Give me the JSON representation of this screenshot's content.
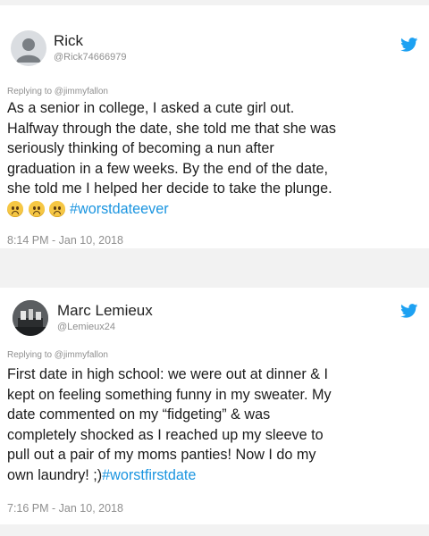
{
  "colors": {
    "accent": "#1b95e0",
    "muted": "#8f8f8f"
  },
  "tweets": [
    {
      "name": "Rick",
      "handle": "@Rick74666979",
      "replying": "Replying to @jimmyfallon",
      "lines": [
        "As a senior in college, I asked a cute girl out.",
        "Halfway through the date, she told me that she was",
        "seriously thinking of becoming a nun after",
        "graduation in a few weeks. By the end of the date,",
        "she told me I helped her decide to take the plunge."
      ],
      "emoji": "worried-face-icon",
      "hashtag": "#worstdateever",
      "timestamp": "8:14 PM - Jan 10, 2018"
    },
    {
      "name": "Marc Lemieux",
      "handle": "@Lemieux24",
      "replying": "Replying to @jimmyfallon",
      "lines": [
        "First date in high school: we were out at dinner & I",
        "kept on feeling something funny in my sweater. My",
        "date commented on my “fidgeting” & was",
        "completely shocked as I reached up my sleeve to",
        "pull out a pair of my moms panties!  Now I do my"
      ],
      "last_line_text": "own laundry! ;)",
      "hashtag": "#worstfirstdate",
      "timestamp": "7:16 PM - Jan 10, 2018"
    }
  ]
}
